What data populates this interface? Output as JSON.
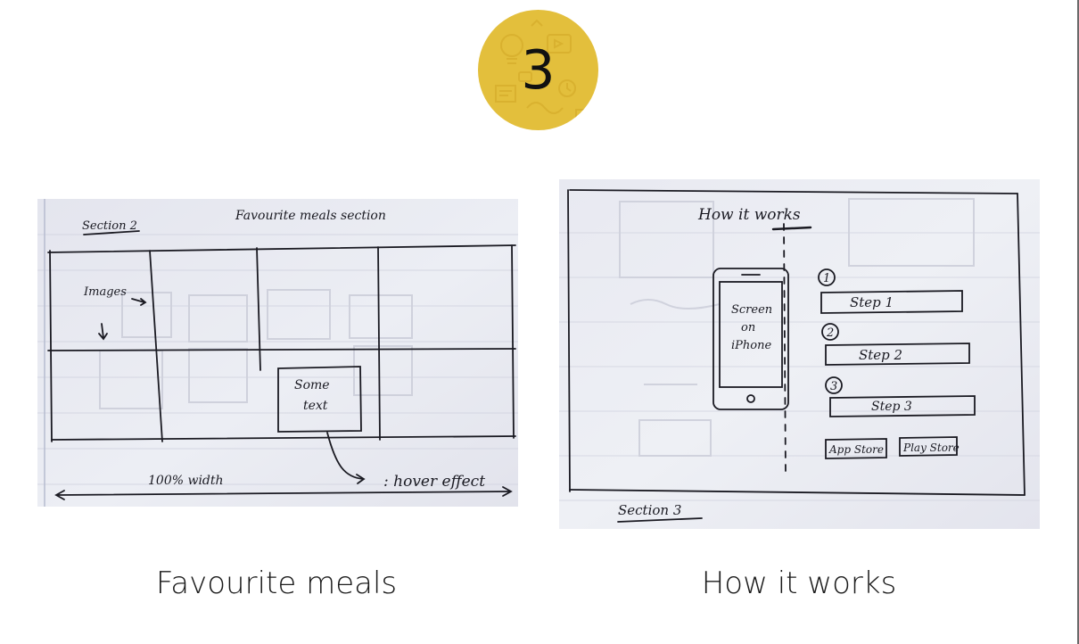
{
  "slide": {
    "step_number": "3",
    "colors": {
      "badge": "#e3bf3c",
      "paper": "#eaeaf0",
      "ink": "#1a1a22"
    }
  },
  "sketches": [
    {
      "caption": "Favourite meals",
      "notes": {
        "section_label": "Section 2",
        "title": "Favourite meals section",
        "images_note": "Images",
        "box_text_line1": "Some",
        "box_text_line2": "text",
        "width_note": "100% width",
        "hover_note": ": hover effect"
      }
    },
    {
      "caption": "How it works",
      "notes": {
        "title": "How it works",
        "phone_line1": "Screen",
        "phone_line2": "on",
        "phone_line3": "iPhone",
        "step_1_number": "1",
        "step_1_label": "Step 1",
        "step_2_number": "2",
        "step_2_label": "Step 2",
        "step_3_number": "3",
        "step_3_label": "Step 3",
        "app_store": "App Store",
        "play_store": "Play Store",
        "section_label": "Section 3"
      }
    }
  ]
}
